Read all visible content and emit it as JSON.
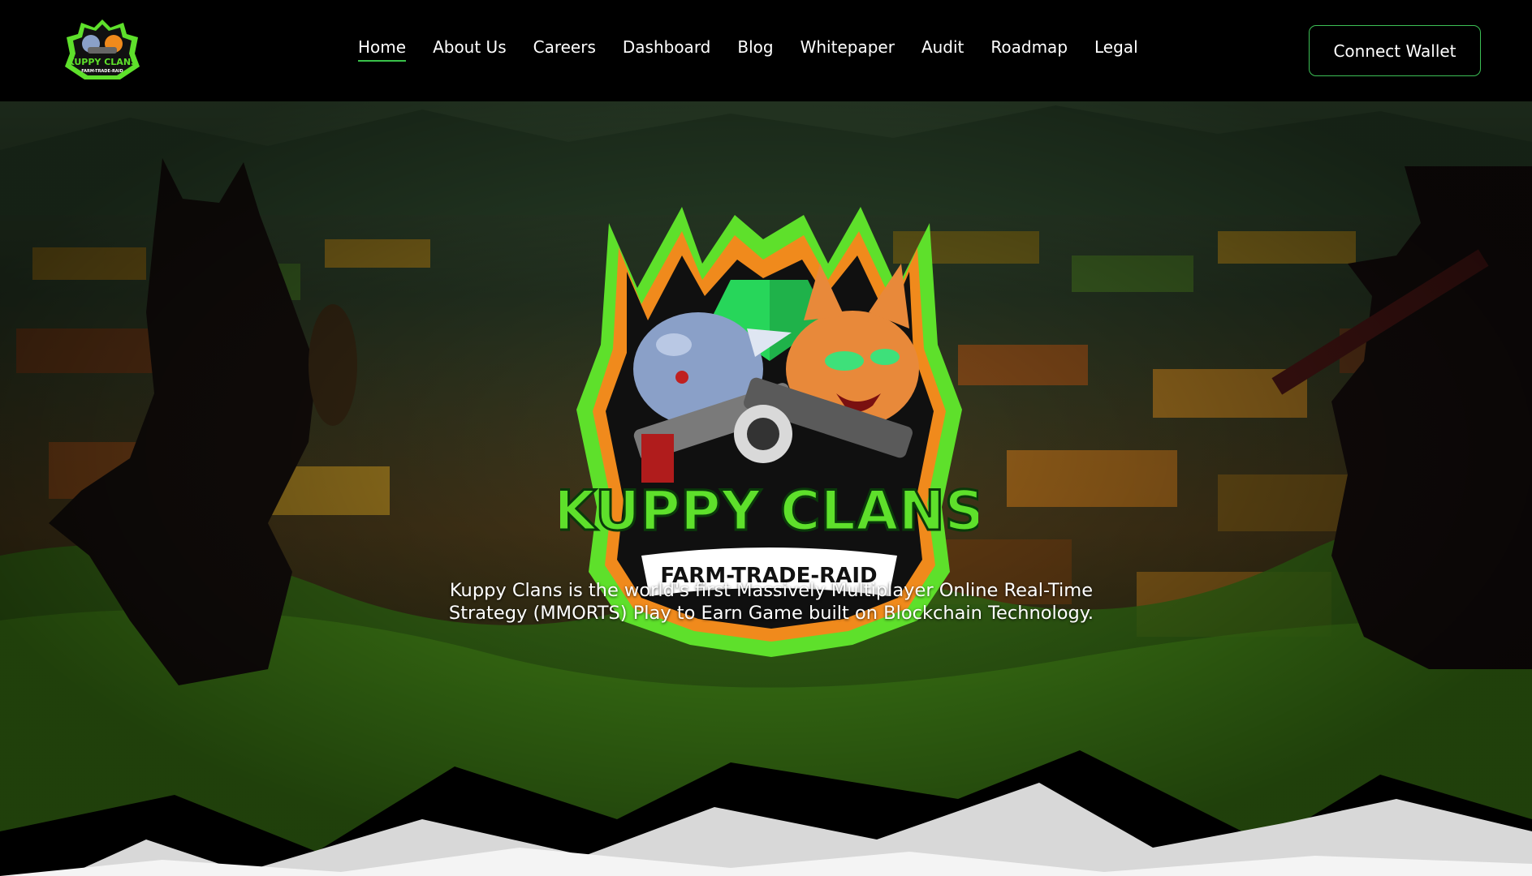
{
  "nav": {
    "logo": {
      "icon": "kuppy-clans-logo-icon",
      "line1": "KUPPY CLANS",
      "line2": "FARM-TRADE-RAID"
    },
    "links": [
      {
        "label": "Home",
        "active": true
      },
      {
        "label": "About Us",
        "active": false
      },
      {
        "label": "Careers",
        "active": false
      },
      {
        "label": "Dashboard",
        "active": false
      },
      {
        "label": "Blog",
        "active": false
      },
      {
        "label": "Whitepaper",
        "active": false
      },
      {
        "label": "Audit",
        "active": false
      },
      {
        "label": "Roadmap",
        "active": false
      },
      {
        "label": "Legal",
        "active": false
      }
    ],
    "connect_wallet_label": "Connect Wallet"
  },
  "hero": {
    "logo": {
      "title": "KUPPY CLANS",
      "subtitle": "FARM-TRADE-RAID"
    },
    "tagline_line1": "Kuppy Clans is the world's first Massively Multiplayer Online Real-Time",
    "tagline_line2": "Strategy (MMORTS) Play to Earn Game built on Blockchain Technology."
  },
  "colors": {
    "nav_bg": "#000000",
    "accent_green": "#3cbf55",
    "logo_green": "#5ee02b",
    "logo_orange": "#f08a1c",
    "text_white": "#ffffff"
  }
}
